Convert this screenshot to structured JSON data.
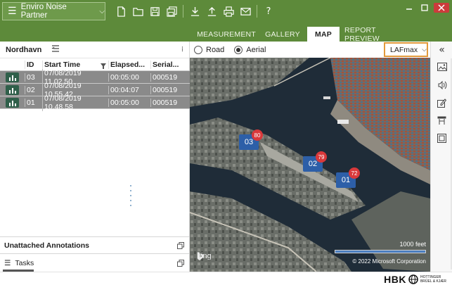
{
  "app": {
    "title": "Enviro Noise Partner",
    "window_controls": [
      "minimize-icon",
      "maximize-icon",
      "close-icon"
    ],
    "toolbar_icons": [
      "new-file-icon",
      "open-folder-icon",
      "save-icon",
      "save-all-icon",
      "download-icon",
      "upload-icon",
      "print-icon",
      "email-icon",
      "help-icon"
    ],
    "help_label": "?",
    "accent": "#5d8a3a"
  },
  "tabs": [
    {
      "label": "MEASUREMENT",
      "active": false
    },
    {
      "label": "GALLERY",
      "active": false
    },
    {
      "label": "MAP",
      "active": true
    },
    {
      "label": "REPORT PREVIEW",
      "active": false
    }
  ],
  "left": {
    "project": "Nordhavn",
    "columns": [
      "ID",
      "Start Time",
      "Elapsed...",
      "Serial..."
    ],
    "rows": [
      {
        "id": "03",
        "start": "07/08/2019 11.02.50",
        "elapsed": "00:05:00",
        "serial": "000519"
      },
      {
        "id": "02",
        "start": "07/08/2019 10.55.42",
        "elapsed": "00:04:07",
        "serial": "000519"
      },
      {
        "id": "01",
        "start": "07/08/2019 10.48.58",
        "elapsed": "00:05:00",
        "serial": "000519"
      }
    ],
    "annotations_label": "Unattached Annotations",
    "tasks_label": "Tasks"
  },
  "map": {
    "view_options": [
      {
        "label": "Road",
        "selected": false
      },
      {
        "label": "Aerial",
        "selected": true
      }
    ],
    "metric": "LAFmax",
    "markers": [
      {
        "id": "03",
        "level": "80"
      },
      {
        "id": "02",
        "level": "79"
      },
      {
        "id": "01",
        "level": "72"
      }
    ],
    "scale_label": "1000 feet",
    "copyright": "© 2022 Microsoft Corporation",
    "provider": "bing"
  },
  "rail_icons": [
    "collapse-icon",
    "image-icon",
    "audio-icon",
    "note-icon",
    "marker-icon",
    "picture-frame-icon"
  ],
  "footer": {
    "brand": "HBK",
    "brand_sub_1": "HOTTINGER",
    "brand_sub_2": "BRÜEL & KJÆR"
  }
}
